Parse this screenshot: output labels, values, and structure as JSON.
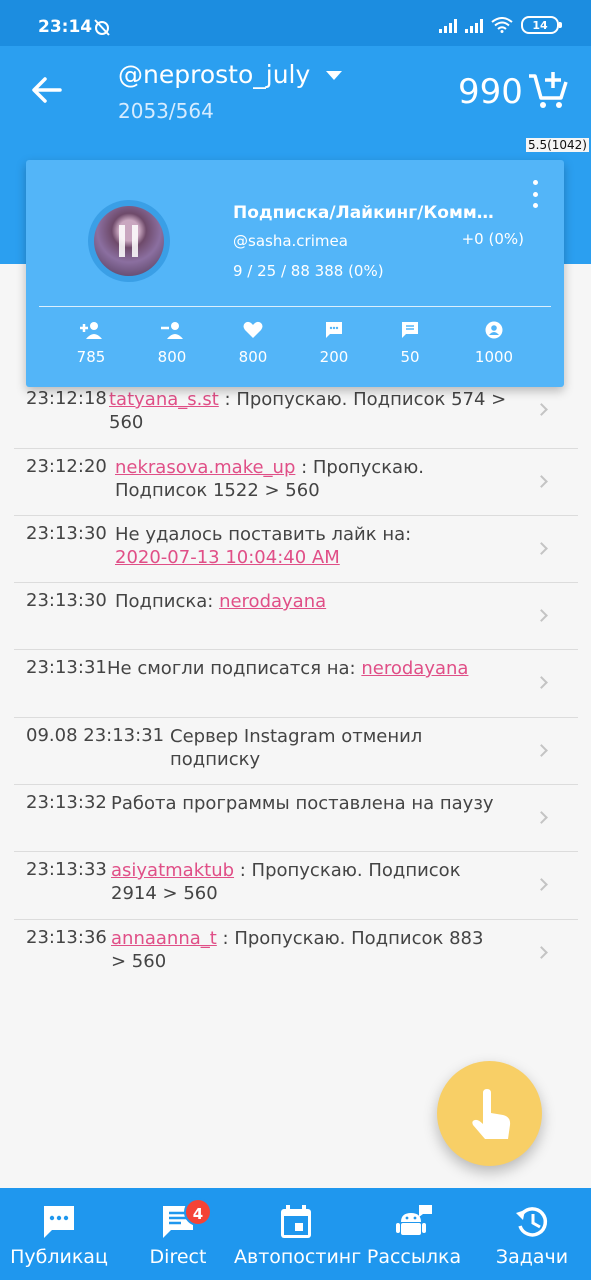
{
  "status_bar": {
    "time": "23:14",
    "battery": "14"
  },
  "header": {
    "username": "@neprosto_july",
    "follow_stats": "2053/564",
    "balance": "990"
  },
  "version": "5.5(1042)",
  "task_card": {
    "title": "Подписка/Лайкинг/Коммен...",
    "account": "@sasha.crimea",
    "delta": "+0 (0%)",
    "progress": "9 / 25 / 88 388 (0%)",
    "limits": [
      {
        "icon": "follow-icon",
        "value": "785"
      },
      {
        "icon": "unfollow-icon",
        "value": "800"
      },
      {
        "icon": "like-icon",
        "value": "800"
      },
      {
        "icon": "comment-icon",
        "value": "200"
      },
      {
        "icon": "message-icon",
        "value": "50"
      },
      {
        "icon": "profile-icon",
        "value": "1000"
      }
    ]
  },
  "log": [
    {
      "time": "23:12:18",
      "link": "tatyana_s.st",
      "text": " : Пропускаю. Подписок 574 > 560"
    },
    {
      "time": "23:12:20",
      "link": "nekrasova.make_up",
      "text": " : Пропускаю. Подписок 1522 > 560"
    },
    {
      "time": "23:13:30",
      "prefix": "Не удалось поставить лайк на:",
      "link": "2020-07-13 10:04:40 AM"
    },
    {
      "time": "23:13:30",
      "prefix": "Подписка:",
      "link": "nerodayana"
    },
    {
      "time": "23:13:31",
      "prefix": "Не смогли подписатся на:",
      "link": "nerodayana"
    },
    {
      "time": "09.08 23:13:31",
      "text": "Сервер Instagram отменил подписку"
    },
    {
      "time": "23:13:32",
      "text": "Работа программы поставлена на паузу"
    },
    {
      "time": "23:13:33",
      "link": "asiyatmaktub",
      "text": " : Пропускаю. Подписок 2914 > 560"
    },
    {
      "time": "23:13:36",
      "link": "annaanna_t",
      "text": " : Пропускаю. Подписок 883 > 560"
    }
  ],
  "bottom_nav": [
    {
      "label": "Публикац",
      "icon": "publications-icon"
    },
    {
      "label": "Direct",
      "icon": "direct-icon",
      "badge": "4"
    },
    {
      "label": "Автопостинг",
      "icon": "calendar-icon"
    },
    {
      "label": "Рассылка",
      "icon": "android-message-icon"
    },
    {
      "label": "Задачи",
      "icon": "history-icon"
    }
  ],
  "colors": {
    "primary": "#2b9ff0",
    "card": "#53b5f8",
    "link": "#e04f87",
    "fab": "#f8cf66"
  }
}
